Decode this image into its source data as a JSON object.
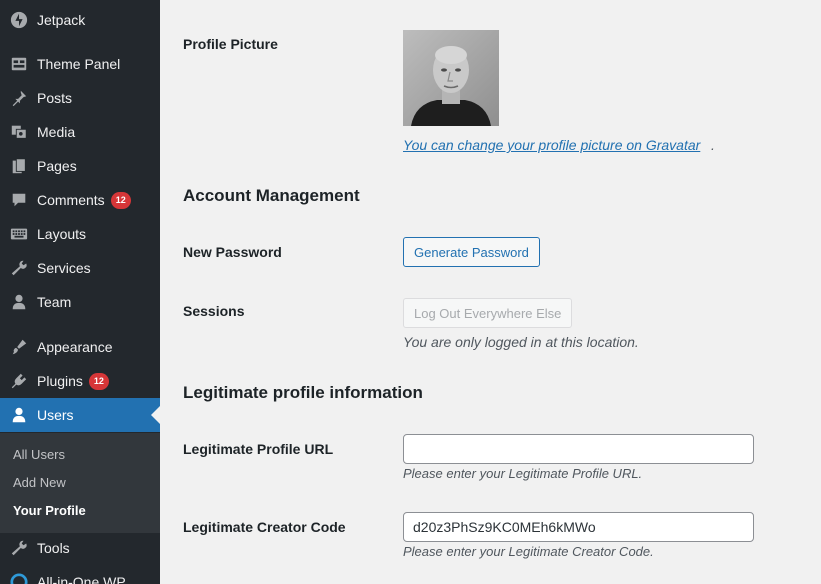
{
  "sidebar": {
    "items": [
      {
        "label": "Jetpack",
        "icon": "jetpack-icon"
      },
      {
        "label": "Theme Panel",
        "icon": "theme-panel-icon"
      },
      {
        "label": "Posts",
        "icon": "pushpin-icon"
      },
      {
        "label": "Media",
        "icon": "media-icon"
      },
      {
        "label": "Pages",
        "icon": "pages-icon"
      },
      {
        "label": "Comments",
        "icon": "comments-icon",
        "badge": "12"
      },
      {
        "label": "Layouts",
        "icon": "layouts-icon"
      },
      {
        "label": "Services",
        "icon": "wrench-icon"
      },
      {
        "label": "Team",
        "icon": "team-icon"
      },
      {
        "label": "Appearance",
        "icon": "paintbrush-icon"
      },
      {
        "label": "Plugins",
        "icon": "plugins-icon",
        "badge": "12"
      },
      {
        "label": "Users",
        "icon": "users-icon",
        "current": true
      },
      {
        "label": "Tools",
        "icon": "tools-icon"
      },
      {
        "label": "All-in-One WP",
        "icon": "migration-icon"
      }
    ],
    "submenu": {
      "all_users": "All Users",
      "add_new": "Add New",
      "your_profile": "Your Profile"
    }
  },
  "profile": {
    "picture_label": "Profile Picture",
    "gravatar_link": "You can change your profile picture on Gravatar",
    "gravatar_period": "."
  },
  "account": {
    "title": "Account Management",
    "new_password_label": "New Password",
    "generate_password_button": "Generate Password",
    "sessions_label": "Sessions",
    "logout_button": "Log Out Everywhere Else",
    "sessions_note": "You are only logged in at this location."
  },
  "legitimate": {
    "title": "Legitimate profile information",
    "url_label": "Legitimate Profile URL",
    "url_value": "",
    "url_desc": "Please enter your Legitimate Profile URL.",
    "creator_label": "Legitimate Creator Code",
    "creator_value": "d20z3PhSz9KC0MEh6kMWo",
    "creator_desc": "Please enter your Legitimate Creator Code."
  },
  "colors": {
    "sidebar_bg": "#23282d",
    "accent": "#2271b1",
    "badge": "#d63638"
  }
}
